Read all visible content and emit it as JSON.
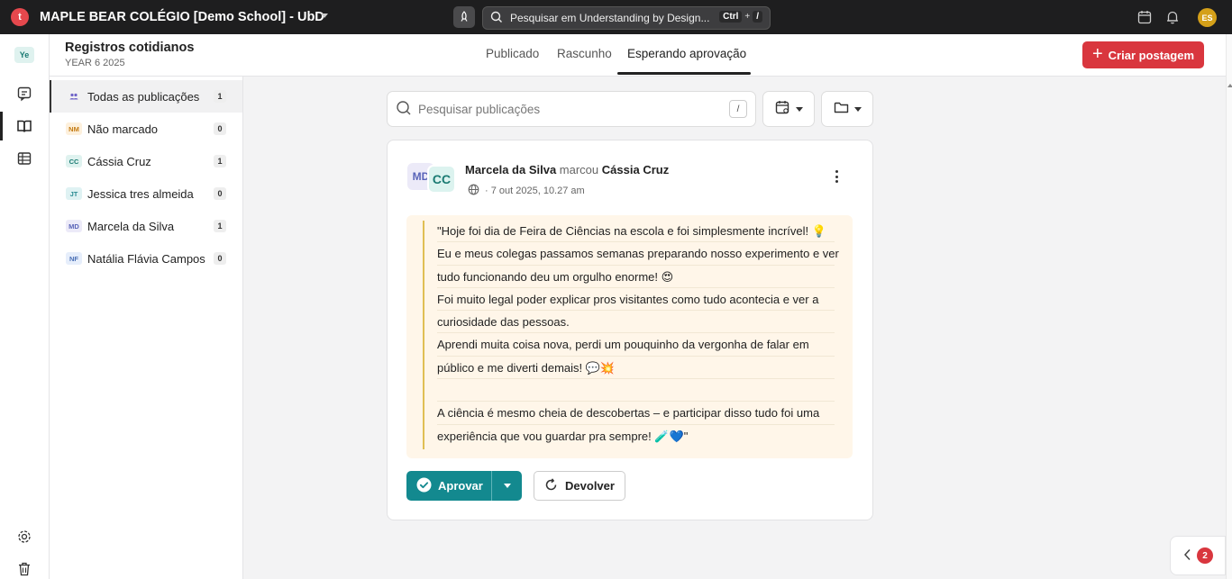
{
  "topbar": {
    "logo_letter": "t",
    "school_title": "MAPLE BEAR COLÉGIO [Demo School] - UbD",
    "search_placeholder": "Pesquisar em Understanding by Design...",
    "shortcut_ctrl": "Ctrl",
    "shortcut_plus": "+",
    "shortcut_key": "/",
    "avatar_initials": "ES",
    "icons": [
      "rocket-icon",
      "search-icon",
      "calendar-icon",
      "bell-icon"
    ]
  },
  "rail": {
    "badge": "Ye",
    "icons": [
      "comment-icon",
      "book-icon",
      "table-icon",
      "settings-icon",
      "trash-icon"
    ]
  },
  "header": {
    "title": "Registros cotidianos",
    "subtitle": "YEAR 6 2025",
    "tabs": [
      {
        "label": "Publicado",
        "active": false
      },
      {
        "label": "Rascunho",
        "active": false
      },
      {
        "label": "Esperando aprovação",
        "active": true
      }
    ],
    "create_button": "Criar postagem"
  },
  "sidebar": {
    "items": [
      {
        "tag": "",
        "label": "Todas as publicações",
        "count": "1",
        "active": true
      },
      {
        "tag": "NM",
        "label": "Não marcado",
        "count": "0",
        "tag_bg": "#fdf0dc",
        "tag_color": "#c47a10"
      },
      {
        "tag": "CC",
        "label": "Cássia Cruz",
        "count": "1",
        "tag_bg": "#dff2ef",
        "tag_color": "#1a7a72"
      },
      {
        "tag": "JT",
        "label": "Jessica tres almeida",
        "count": "0",
        "tag_bg": "#dff2f3",
        "tag_color": "#2a8a92"
      },
      {
        "tag": "MD",
        "label": "Marcela da Silva",
        "count": "1",
        "tag_bg": "#eceaf8",
        "tag_color": "#5964b8"
      },
      {
        "tag": "NF",
        "label": "Natália Flávia Campos",
        "count": "0",
        "tag_bg": "#e6eefb",
        "tag_color": "#4a6fb5"
      }
    ]
  },
  "main": {
    "search_placeholder": "Pesquisar publicações",
    "search_shortcut": "/",
    "post": {
      "avatar_primary": "MD",
      "avatar_secondary": "CC",
      "author": "Marcela da Silva",
      "verb": "marcou",
      "tagged": "Cássia Cruz",
      "meta": "· 7 out 2025, 10.27 am",
      "lines": [
        "\"Hoje foi dia de Feira de Ciências na escola e foi simplesmente incrível! 💡",
        "Eu e meus colegas passamos semanas preparando nosso experimento e ver",
        "tudo funcionando deu um orgulho enorme! 😍",
        "Foi muito legal poder explicar pros visitantes como tudo acontecia e ver a",
        "curiosidade das pessoas.",
        "Aprendi muita coisa nova, perdi um pouquinho da vergonha de falar em",
        "público e me diverti demais! 💬💥",
        "",
        "A ciência é mesmo cheia de descobertas – e participar disso tudo foi uma",
        "experiência que vou guardar pra sempre! 🧪💙\""
      ],
      "approve_label": "Aprovar",
      "return_label": "Devolver"
    }
  },
  "notifications": {
    "count": "2"
  },
  "colors": {
    "accent_red": "#d9363e",
    "teal": "#13898f",
    "quote_bg": "#fff6e9"
  }
}
